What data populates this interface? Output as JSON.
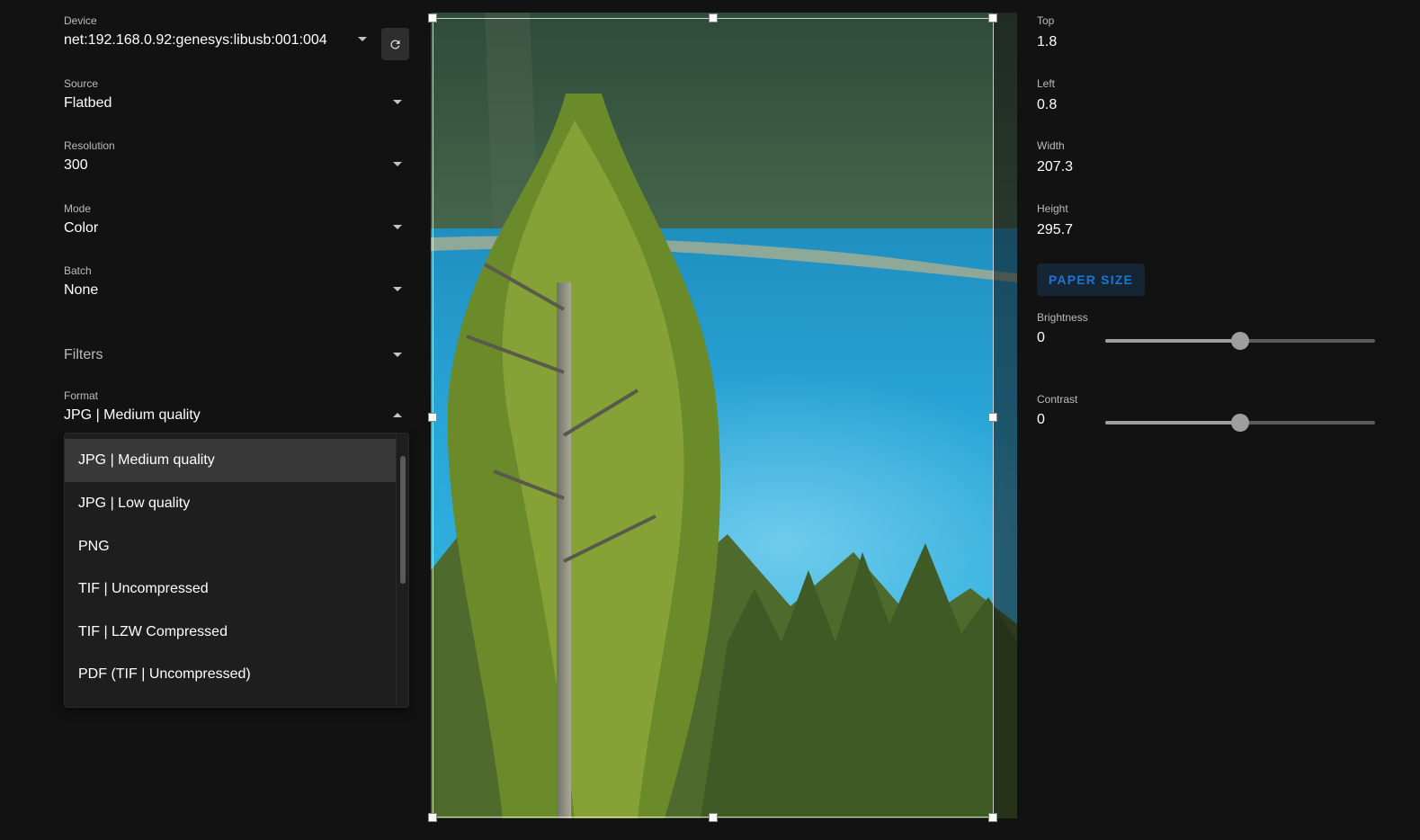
{
  "device": {
    "label": "Device",
    "value": "net:192.168.0.92:genesys:libusb:001:004"
  },
  "source": {
    "label": "Source",
    "value": "Flatbed"
  },
  "resolution": {
    "label": "Resolution",
    "value": "300"
  },
  "mode": {
    "label": "Mode",
    "value": "Color"
  },
  "batch": {
    "label": "Batch",
    "value": "None"
  },
  "filters": {
    "label": "Filters"
  },
  "format": {
    "label": "Format",
    "value": "JPG | Medium quality",
    "options": [
      "JPG | Medium quality",
      "JPG | Low quality",
      "PNG",
      "TIF | Uncompressed",
      "TIF | LZW Compressed",
      "PDF (TIF | Uncompressed)"
    ],
    "selected_index": 0
  },
  "geometry_fields": {
    "top": {
      "label": "Top",
      "value": "1.8"
    },
    "left": {
      "label": "Left",
      "value": "0.8"
    },
    "width": {
      "label": "Width",
      "value": "207.3"
    },
    "height": {
      "label": "Height",
      "value": "295.7"
    }
  },
  "paper_size_button": "PAPER SIZE",
  "brightness": {
    "label": "Brightness",
    "value": "0",
    "level": 0.5
  },
  "contrast": {
    "label": "Contrast",
    "value": "0",
    "level": 0.5
  },
  "colors": {
    "background": "#121212",
    "accent": "#1976d2",
    "menu_bg": "#1e1e1e",
    "menu_selected": "#383838"
  },
  "icons": {
    "refresh": "refresh-icon",
    "dropdown": "caret-down-icon"
  }
}
